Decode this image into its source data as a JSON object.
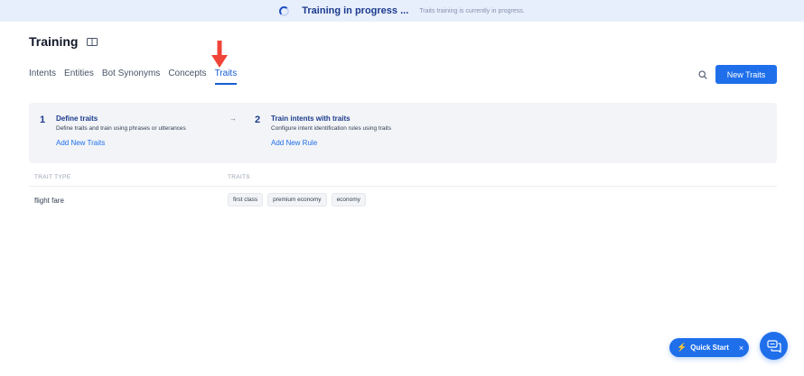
{
  "banner": {
    "title": "Training in progress ...",
    "subtitle": "Traits training is currently in progress."
  },
  "page": {
    "title": "Training"
  },
  "tabs": [
    {
      "label": "Intents"
    },
    {
      "label": "Entities"
    },
    {
      "label": "Bot Synonyms"
    },
    {
      "label": "Concepts"
    },
    {
      "label": "Traits",
      "active": true
    }
  ],
  "toolbar": {
    "new_traits_label": "New Traits"
  },
  "steps": [
    {
      "number": "1",
      "title": "Define traits",
      "description": "Define traits and train using phrases or utterances",
      "link": "Add New Traits"
    },
    {
      "number": "2",
      "title": "Train intents with traits",
      "description": "Configure intent identification rules using traits",
      "link": "Add New Rule"
    }
  ],
  "step_arrow": "→",
  "table": {
    "headers": {
      "type": "TRAIT TYPE",
      "traits": "TRAITS"
    },
    "rows": [
      {
        "type": "flight fare",
        "traits": [
          "first class",
          "premium economy",
          "economy"
        ]
      }
    ]
  },
  "quick_start": {
    "label": "Quick Start",
    "close": "×"
  },
  "colors": {
    "accent": "#1f6feb",
    "annotation_arrow": "#f04438"
  },
  "icons": [
    "spinner-icon",
    "book-icon",
    "search-icon",
    "bolt-icon",
    "close-icon",
    "chat-icon",
    "red-arrow-annotation"
  ]
}
